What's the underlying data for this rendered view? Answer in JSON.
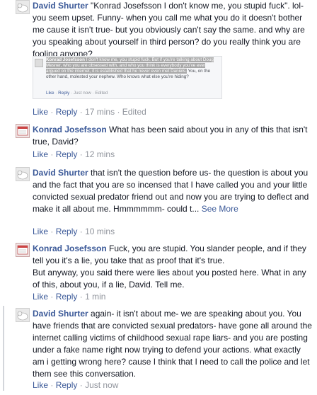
{
  "comments": [
    {
      "author": "David Shurter",
      "text": "\"Konrad Josefsson I don't know me, you stupid fuck\". lol- you seem upset. Funny- when you call me what you do it doesn't bother me cause it isn't true- but you obviously can't say the same. and why are you speaking about yourself in third person? do you really think you are fooling anyone?",
      "like": "Like",
      "reply": "Reply",
      "time": "17 mins",
      "edited": "Edited"
    },
    {
      "author": "Konrad Josefsson",
      "text": "What has been said about you in any of this that isn't true, David?",
      "like": "Like",
      "reply": "Reply",
      "time": "12 mins"
    },
    {
      "author": "David Shurter",
      "text": "that isn't the question before us- the question is about you and the fact that you are so incensed that I have called you and your little convicted sexual predator friend out and now you are trying to deflect and make it all about me. Hmmmmmm- could t...",
      "see_more": "See More",
      "like": "Like",
      "reply": "Reply",
      "time": "10 mins"
    },
    {
      "author": "Konrad Josefsson",
      "text": "Fuck, you are stupid. You slander people, and if they tell you it's a lie, you take that as proof that it's true.",
      "text2": "But anyway, you said there were lies about you posted here. What in any of this, about you, if a lie, David. Tell me.",
      "like": "Like",
      "reply": "Reply",
      "time": "1 min"
    },
    {
      "author": "David Shurter",
      "text": "again- it isn't about me- we are speaking about you. You have friends that are convicted sexual predators- have gone all around the internet calling victims of childhood sexual rape liars- and you are posting under a fake name right now trying to defend your actions. what exactly am i getting wrong here? cause I think that I need to call the police and let them see this conversation.",
      "like": "Like",
      "reply": "Reply",
      "time": "Just now"
    }
  ],
  "quote": {
    "author": "Konrad Josefsson",
    "highlighted": "I don't know me, you stupid fuck. But if you're talking about Doug Mesner, who you are obsessed with, and who you think is everybody you've ever argued on the internet, it is established that he never even met Daniels.",
    "rest": "You, on the other hand, molested your nephew. Who knows what else you're hiding?",
    "like": "Like",
    "reply": "Reply",
    "time": "Just now",
    "edited": "Edited"
  },
  "separators": {
    "dot": "·"
  },
  "colors": {
    "link": "#3b5998",
    "meta": "#90949c",
    "text": "#141823"
  }
}
